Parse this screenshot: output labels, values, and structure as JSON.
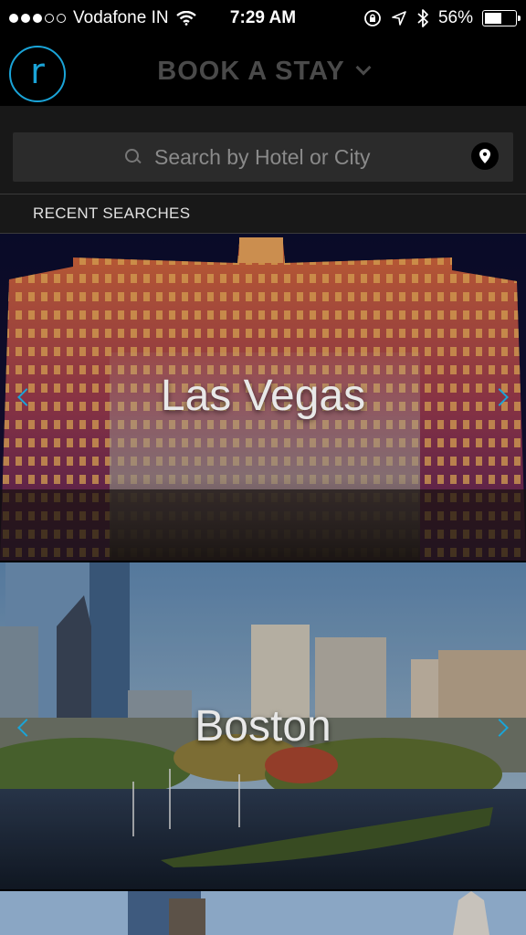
{
  "status_bar": {
    "carrier": "Vodafone IN",
    "time": "7:29 AM",
    "battery": "56%",
    "battery_level": 0.56,
    "signal_filled": 3,
    "signal_total": 5
  },
  "header": {
    "logo_letter": "r",
    "title": "BOOK A STAY",
    "accent_color": "#1aa4d8"
  },
  "search": {
    "placeholder": "Search by Hotel or City",
    "value": ""
  },
  "recent": {
    "label": "RECENT SEARCHES"
  },
  "cities": [
    {
      "name": "Las Vegas"
    },
    {
      "name": "Boston"
    }
  ],
  "icons": {
    "search": "search-icon",
    "location": "location-pin-icon",
    "wifi": "wifi-icon",
    "bluetooth": "bluetooth-icon",
    "chevron_left": "chevron-left-icon",
    "chevron_right": "chevron-right-icon"
  }
}
